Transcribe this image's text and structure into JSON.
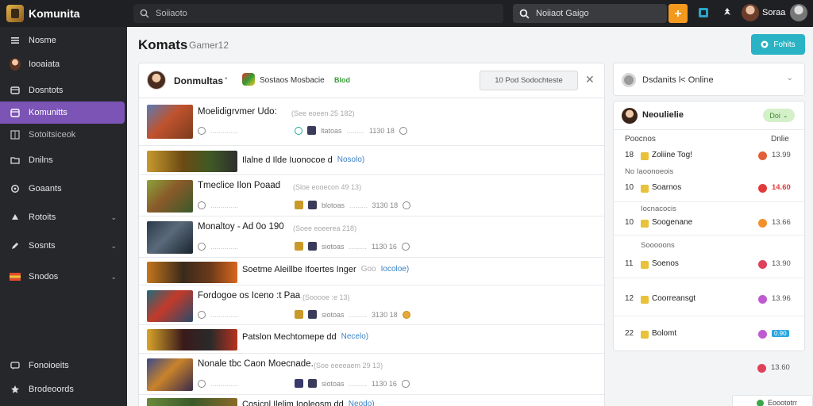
{
  "app": {
    "name": "Komunita"
  },
  "topbar": {
    "search_placeholder": "Soiiaoto",
    "search2_placeholder": "Noiiaot Gaigo",
    "user_name": "Soraa"
  },
  "sidebar": {
    "items": [
      {
        "label": "Nosme",
        "icon": "home-icon"
      },
      {
        "label": "Iooaiata",
        "icon": "avatar-icon"
      },
      {
        "label": "Dosntots",
        "icon": "box-icon"
      },
      {
        "label": "Komunitts",
        "icon": "calendar-icon",
        "active": true
      },
      {
        "label": "Sotoitsiceok",
        "icon": "grid-icon"
      },
      {
        "label": "Dnilns",
        "icon": "folder-icon"
      },
      {
        "label": "Goaants",
        "icon": "refresh-icon"
      },
      {
        "label": "Rotoits",
        "icon": "trophy-icon",
        "chevron": true
      },
      {
        "label": "Sosnts",
        "icon": "pen-icon",
        "chevron": true
      },
      {
        "label": "Snodos",
        "icon": "flag-icon",
        "chevron": true
      },
      {
        "label": "Fonoioeits",
        "icon": "chat-icon"
      },
      {
        "label": "Brodeoords",
        "icon": "star-icon"
      }
    ]
  },
  "page": {
    "title": "Komats",
    "subtitle": "Gamer12",
    "new_button": "Fohits"
  },
  "feed": {
    "header": {
      "title": "Donmultas",
      "games_label": "Sostaos Mosbacie",
      "tag": "Blod",
      "button": "10 Pod Sodochteste"
    },
    "rows": [
      {
        "type": "item",
        "title": "Moelidigrvmer Udo:",
        "meta": "(See eoeen 25 182)",
        "line": "ltatoas",
        "time": "1130 18"
      },
      {
        "type": "banner",
        "title": "Ilalne d Ilde Iuonocoe d",
        "link": "Nosolo)"
      },
      {
        "type": "item",
        "title": "Tmeclice Ilon Poaad",
        "meta": "(Sloe eooecon 49 13)",
        "line": "blotoas",
        "time": "3130 18"
      },
      {
        "type": "item",
        "title": "Monaltoy - Ad 0o 190",
        "meta": "(Soee eoeerea 218)",
        "line": "siotoas",
        "time": "1130 16"
      },
      {
        "type": "banner",
        "title": "Soetme Aleillbe Ifoertes Inger",
        "link": "Iocoloe)",
        "prefix": "Goo"
      },
      {
        "type": "item",
        "title": "Fordogoe os Iceno :t Paa",
        "meta": "(Sooooe :e 13)",
        "line": "siotoas",
        "time": "3130 18"
      },
      {
        "type": "banner",
        "title": "Patslon Mechtomepe dd",
        "link": "Necelo)"
      },
      {
        "type": "item",
        "title": "Nonale tbc Caon Moecnade.",
        "meta": "(Soe eeeeaem 29 13)",
        "line": "siotoas",
        "time": "1130 16"
      },
      {
        "type": "banner",
        "title": "Cosicnl Ilelim Iooleosm dd",
        "link": "Neodo)"
      }
    ]
  },
  "online": {
    "label": "Dsdanits l< Online"
  },
  "leaderboard": {
    "title": "Neoulielie",
    "pill": "Doi",
    "col_left": "Poocnos",
    "col_right": "Dnlie",
    "sections": [
      "No Iaoonoeois",
      "Iocnacocis",
      "Sooooons"
    ],
    "rows": [
      {
        "num": "18",
        "name": "Zoliine Tog!",
        "value": "13.99",
        "dot": "#e0603a",
        "icon": "#e7c23a"
      },
      {
        "num": "10",
        "name": "Soarnos",
        "value": "14.60",
        "dot": "#e23a3a",
        "icon": "#e7c23a",
        "highlight": true
      },
      {
        "num": "10",
        "name": "Soogenane",
        "value": "13.66",
        "dot": "#f0912b",
        "icon": "#e7c23a"
      },
      {
        "num": "11",
        "name": "Soenos",
        "value": "13.90",
        "dot": "#e0405a",
        "icon": "#e7c23a"
      },
      {
        "num": "12",
        "name": "Coorreansgt",
        "value": "13.96",
        "dot": "#c05ad0",
        "icon": "#e7c23a"
      },
      {
        "num": "22",
        "name": "Bolomt",
        "value": "0.90",
        "dot": "#c05ad0",
        "icon": "#e7c23a",
        "badge": true
      },
      {
        "num": "",
        "name": "",
        "value": "13.60",
        "dot": "#e0405a",
        "icon": ""
      }
    ],
    "footer": "Eooototrr"
  }
}
